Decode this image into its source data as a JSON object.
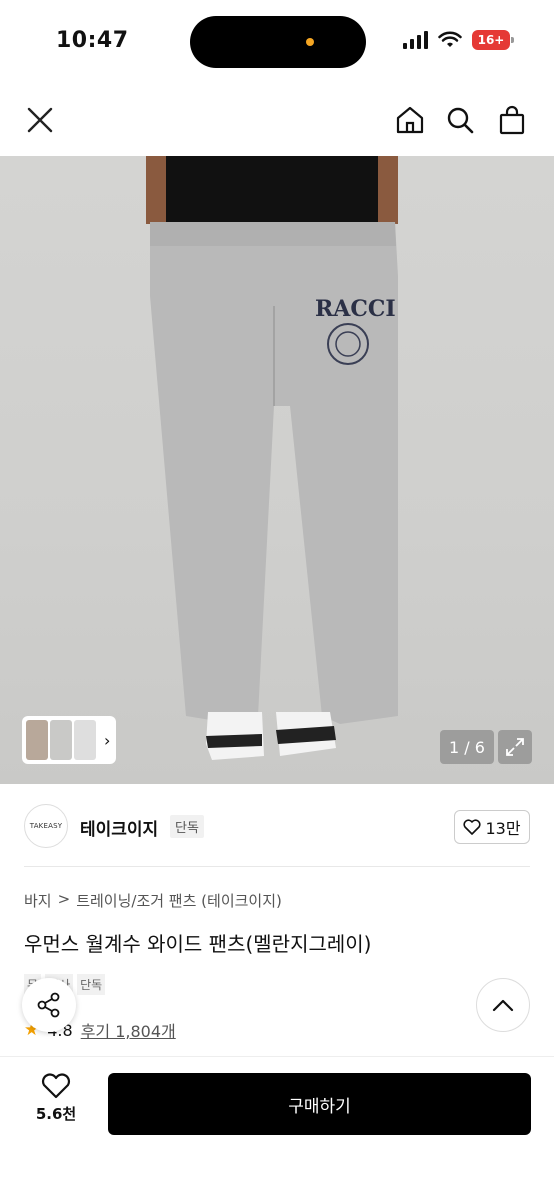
{
  "status_bar": {
    "time": "10:47",
    "battery": "16+"
  },
  "nav": {
    "close_icon": "close-icon",
    "home_icon": "home-icon",
    "search_icon": "search-icon",
    "bag_icon": "shopping-bag-icon"
  },
  "gallery": {
    "page_indicator": "1 / 6",
    "logo_text": "RACCI"
  },
  "brand": {
    "logo_text": "TAKEASY",
    "name": "테이크이지",
    "tag": "단독",
    "likes": "13만"
  },
  "product": {
    "breadcrumb": [
      "바지",
      "트레이닝/조거 팬츠 (테이크이지)"
    ],
    "title": "우먼스 월계수 와이드 팬츠(멜란지그레이)",
    "tags": [
      "무",
      "신사",
      "단독"
    ],
    "rating": "4.8",
    "reviews": "후기 1,804개"
  },
  "bottom_bar": {
    "wish_count": "5.6천",
    "buy_label": "구매하기"
  },
  "colors": {
    "accent": "#000000",
    "battery": "#e53935",
    "star": "#f4a100"
  }
}
